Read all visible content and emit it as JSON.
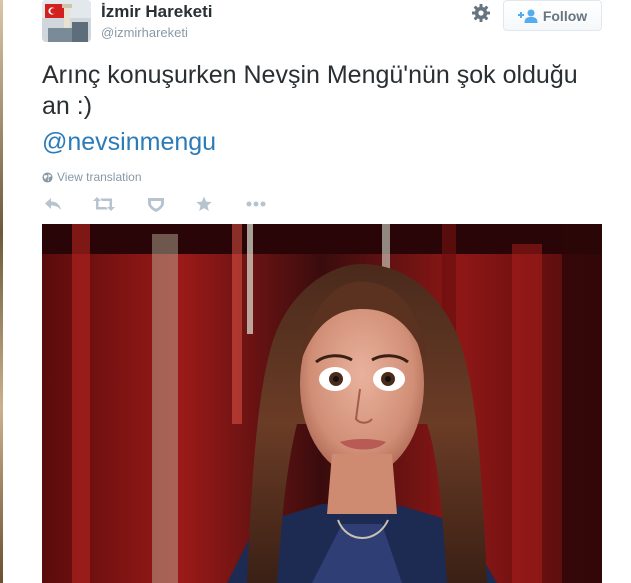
{
  "tweet": {
    "author_name": "İzmir Hareketi",
    "author_handle": "@izmirhareketi",
    "follow_label": "Follow",
    "text": "Arınç konuşurken Nevşin Mengü'nün şok olduğu an :)",
    "mention": "@nevsinmengu",
    "view_translation_label": "View translation"
  },
  "icons": {
    "settings": "gear-icon",
    "follow": "follow-user-icon",
    "translate": "globe-icon",
    "reply": "reply-icon",
    "retweet": "retweet-icon",
    "favorite": "heart-icon",
    "star": "star-icon",
    "more": "more-icon"
  },
  "colors": {
    "text": "#292f33",
    "link": "#2b7bb9",
    "muted": "#8899a6",
    "action_icon": "#b7c4cf",
    "follow_icon": "#55acee"
  }
}
